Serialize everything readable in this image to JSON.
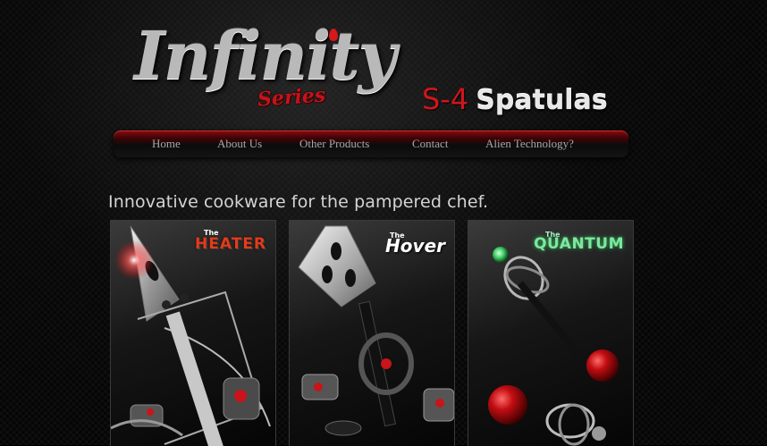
{
  "header": {
    "logo_main": "Infinity",
    "logo_sub": "Series",
    "product_code": "S-4",
    "product_name": "Spatulas"
  },
  "nav": {
    "items": [
      {
        "label": "Home"
      },
      {
        "label": "About Us"
      },
      {
        "label": "Other Products"
      },
      {
        "label": "Contact"
      },
      {
        "label": "Alien Technology?"
      }
    ]
  },
  "main": {
    "tagline": "Innovative cookware for the pampered chef.",
    "products": [
      {
        "prefix": "The",
        "name": "HEATER",
        "title_color": "#e33b1a"
      },
      {
        "prefix": "The",
        "name": "Hover",
        "title_color": "#ffffff"
      },
      {
        "prefix": "The",
        "name": "QUANTUM",
        "title_color": "#7fe6a0"
      }
    ]
  },
  "colors": {
    "accent_red": "#c4131b",
    "background": "#000000",
    "nav_text": "#a8a8a8"
  }
}
